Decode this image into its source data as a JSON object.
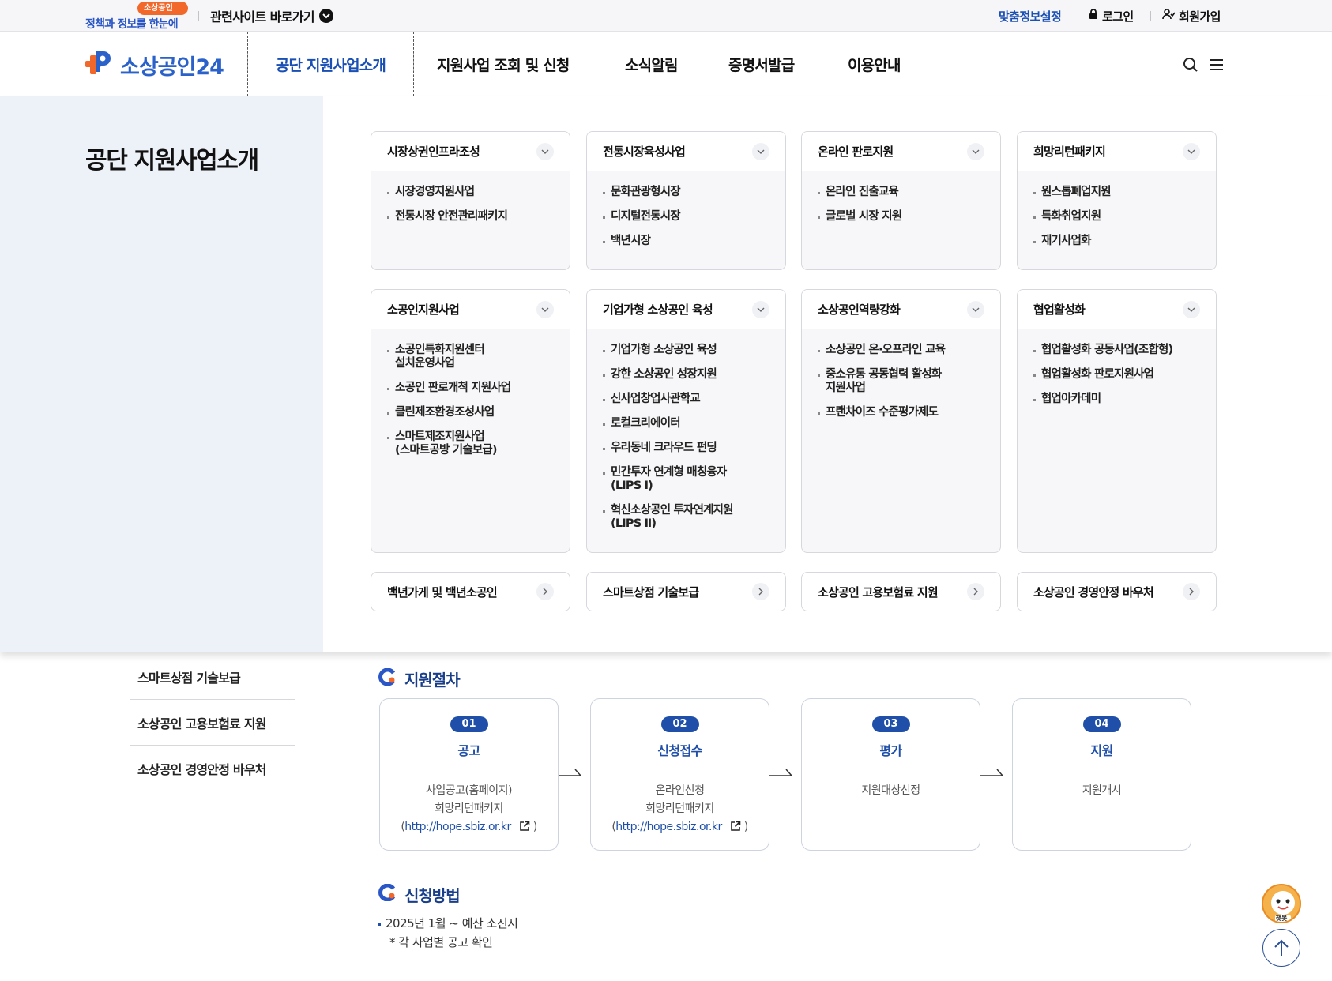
{
  "topbar": {
    "promo_badge": "소상공인24",
    "promo_text": "정책과 정보를 한눈에",
    "related_sites": "관련사이트 바로가기",
    "custom_info": "맞춤정보설정",
    "login": "로그인",
    "signup": "회원가입"
  },
  "header": {
    "logo_text": "소상공인24",
    "gnb": [
      "공단 지원사업소개",
      "지원사업 조회 및 신청",
      "소식알림",
      "증명서발급",
      "이용안내"
    ]
  },
  "mega": {
    "title": "공단 지원사업소개",
    "cards": [
      {
        "title": "시장상권인프라조성",
        "items": [
          "시장경영지원사업",
          "전통시장 안전관리패키지"
        ]
      },
      {
        "title": "전통시장육성사업",
        "items": [
          "문화관광형시장",
          "디지털전통시장",
          "백년시장"
        ]
      },
      {
        "title": "온라인 판로지원",
        "items": [
          "온라인 진출교육",
          "글로벌 시장 지원"
        ]
      },
      {
        "title": "희망리턴패키지",
        "items": [
          "원스톱폐업지원",
          "특화취업지원",
          "재기사업화"
        ]
      },
      {
        "title": "소공인지원사업",
        "items": [
          "소공인특화지원센터\n설치운영사업",
          "소공인 판로개척 지원사업",
          "클린제조환경조성사업",
          "스마트제조지원사업\n(스마트공방 기술보급)"
        ]
      },
      {
        "title": "기업가형 소상공인 육성",
        "items": [
          "기업가형 소상공인 육성",
          "강한 소상공인 성장지원",
          "신사업창업사관학교",
          "로컬크리에이터",
          "우리동네 크라우드 펀딩",
          "민간투자 연계형 매칭융자\n(LIPS Ⅰ)",
          "혁신소상공인 투자연계지원\n(LIPS Ⅱ)"
        ]
      },
      {
        "title": "소상공인역량강화",
        "items": [
          "소상공인 온·오프라인 교육",
          "중소유통 공동협력 활성화\n지원사업",
          "프랜차이즈 수준평가제도"
        ]
      },
      {
        "title": "협업활성화",
        "items": [
          "협업활성화 공동사업(조합형)",
          "협업활성화 판로지원사업",
          "협업아카데미"
        ]
      }
    ],
    "links": [
      "백년가게 및 백년소공인",
      "스마트상점 기술보급",
      "소상공인 고용보험료 지원",
      "소상공인 경영안정 바우처"
    ]
  },
  "lnb": [
    "스마트상점 기술보급",
    "소상공인 고용보험료 지원",
    "소상공인 경영안정 바우처"
  ],
  "procedure": {
    "title": "지원절차",
    "steps": [
      {
        "num": "01",
        "name": "공고",
        "desc": [
          "사업공고(홈페이지)",
          "희망리턴패키지"
        ],
        "url": "http://hope.sbiz.or.kr"
      },
      {
        "num": "02",
        "name": "신청접수",
        "desc": [
          "온라인신청",
          "희망리턴패키지"
        ],
        "url": "http://hope.sbiz.or.kr"
      },
      {
        "num": "03",
        "name": "평가",
        "desc": [
          "지원대상선정"
        ]
      },
      {
        "num": "04",
        "name": "지원",
        "desc": [
          "지원개시"
        ]
      }
    ]
  },
  "apply": {
    "title": "신청방법",
    "line1": "2025년 1월 ~ 예산 소진시",
    "line2": "* 각 사업별 공고 확인"
  },
  "floating": {
    "chatbot_label": "챗봇"
  },
  "colors": {
    "brand_blue": "#2a62c9",
    "accent_orange": "#f2672a",
    "step_blue": "#1f4fa8",
    "side_bg": "#edf1f8"
  }
}
